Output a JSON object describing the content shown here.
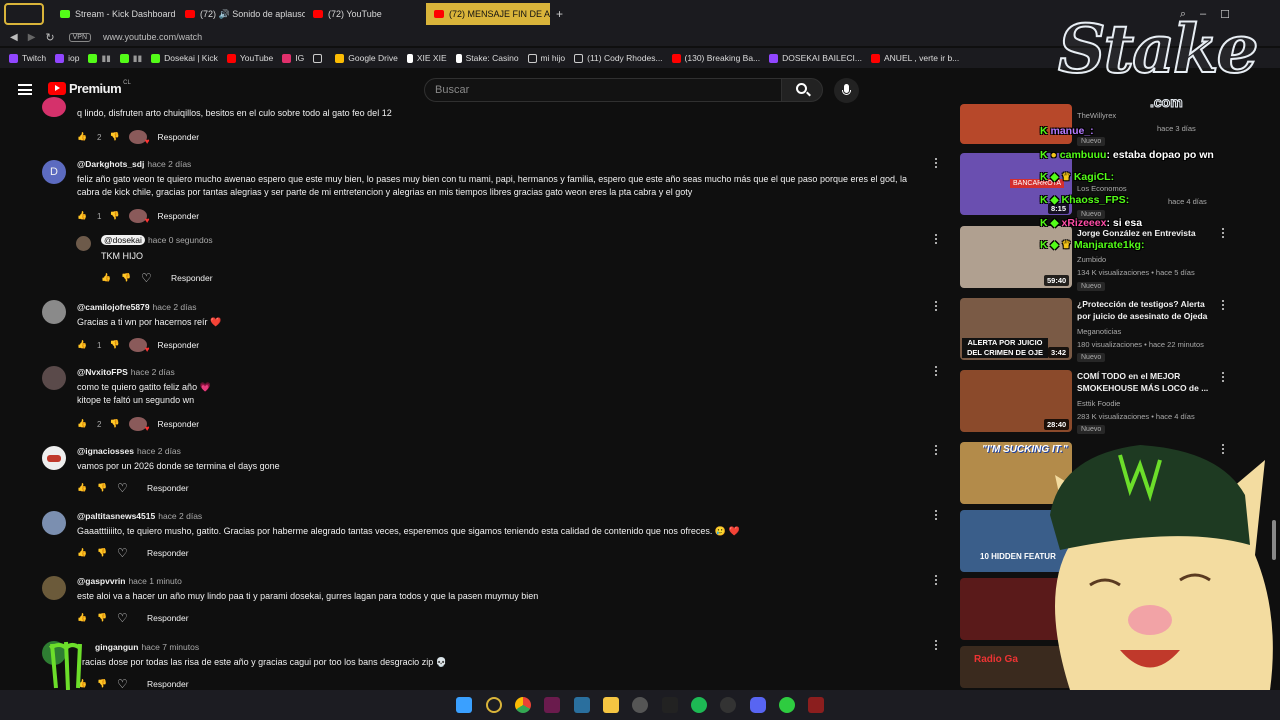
{
  "browser": {
    "tabs": [
      {
        "label": "Stream - Kick Dashboard",
        "color": "#53fc18"
      },
      {
        "label": "(72) 🔊 Sonido de aplauso",
        "color": "#ff0000"
      },
      {
        "label": "(72) YouTube",
        "color": "#ff0000"
      },
      {
        "label": "(72) MENSAJE FIN DE AÑO",
        "color": "#ff0000",
        "active": true
      }
    ],
    "vpn_label": "VPN",
    "url": "www.youtube.com/watch",
    "bookmarks": [
      {
        "label": "Twitch",
        "color": "#9146ff"
      },
      {
        "label": "iop",
        "color": "#9146ff"
      },
      {
        "label": "",
        "color": "#53fc18"
      },
      {
        "label": "",
        "color": "#53fc18"
      },
      {
        "label": "Dosekai | Kick",
        "color": "#53fc18"
      },
      {
        "label": "YouTube",
        "color": "#ff0000"
      },
      {
        "label": "IG",
        "color": "#e1306c"
      },
      {
        "label": "",
        "color": "#dddddd"
      },
      {
        "label": "Google Drive",
        "color": "#fbbc04"
      },
      {
        "label": "XIE XIE",
        "color": "#ffffff"
      },
      {
        "label": "Stake: Casino",
        "color": "#ffffff"
      },
      {
        "label": "mi hijo",
        "color": "#dddddd"
      },
      {
        "label": "(11) Cody Rhodes...",
        "color": "#dddddd"
      },
      {
        "label": "(130) Breaking Ba...",
        "color": "#ff0000"
      },
      {
        "label": "DOSEKAI BAILECI...",
        "color": "#9146ff"
      },
      {
        "label": "ANUEL , verte ir b...",
        "color": "#ff0000"
      }
    ]
  },
  "youtube": {
    "logo_text": "Premium",
    "logo_sup": "CL",
    "search_placeholder": "Buscar"
  },
  "comments": [
    {
      "handle": "",
      "time": "",
      "text": "q lindo, disfruten arto chuiqillos, besitos en el culo sobre todo al gato feo del 12",
      "likes": "2",
      "reply": "Responder",
      "avatar_color": "#d5316b",
      "creator_heart": true
    },
    {
      "handle": "@Darkghots_sdj",
      "time": "hace 2 días",
      "text": "feliz año gato weon te quiero mucho awenao espero que este muy bien, lo pases muy bien con tu mami, papi, hermanos y familia, espero que este año seas mucho más que el que paso porque eres el god, la",
      "text2": "cabra de kick chile, gracias por tantas alegrias y ser parte de mi entretencion y alegrias en mis tiempos libres gracias gato weon eres la pta cabra y el goty",
      "likes": "1",
      "reply": "Responder",
      "avatar_color": "#5c6bc0",
      "avatar_letter": "D",
      "creator_heart": true
    },
    {
      "handle": "@dosekai",
      "time": "hace 0 segundos",
      "text": "TKM HIJO",
      "likes": "",
      "reply": "Responder",
      "avatar_color": "#6d5a4a",
      "reply_thread": true
    },
    {
      "handle": "@camilojofre5879",
      "time": "hace 2 días",
      "text": "Gracias a ti wn por hacernos reír ❤️",
      "likes": "1",
      "reply": "Responder",
      "avatar_color": "#8a8a8a",
      "creator_heart": true
    },
    {
      "handle": "@NvxitoFPS",
      "time": "hace 2 días",
      "text": "como te quiero gatito feliz año 💗",
      "text2": "kitope te faltó un segundo wn",
      "likes": "2",
      "reply": "Responder",
      "avatar_color": "#5a4a4a",
      "creator_heart": true
    },
    {
      "handle": "@ignaciosses",
      "time": "hace 2 días",
      "text": "vamos por un 2026 donde se termina el days gone",
      "likes": "",
      "reply": "Responder",
      "avatar_color": "#c0392b"
    },
    {
      "handle": "@paltitasnews4515",
      "time": "hace 2 días",
      "text": "Gaaatttiiiito, te quiero musho, gatito. Gracias por haberme alegrado tantas veces, esperemos que sigamos teniendo esta calidad de contenido que nos ofreces. 🥲 ❤️",
      "likes": "",
      "reply": "Responder",
      "avatar_color": "#7b8fb0"
    },
    {
      "handle": "@gaspvvrin",
      "time": "hace 1 minuto",
      "text": "este aloi va a hacer un año muy lindo paa ti y parami dosekai, gurres lagan para todos y que la pasen muymuy bien",
      "likes": "",
      "reply": "Responder",
      "avatar_color": "#6b5a3a"
    },
    {
      "handle": "gingangun",
      "time": "hace 7 minutos",
      "text": "racias dose por todas las risa de este año y gracias cagui por too los bans desgracio zip 💀",
      "likes": "",
      "reply": "Responder",
      "avatar_color": "#2e7d32"
    }
  ],
  "sidebar": [
    {
      "title": "",
      "channel": "TheWillyrex",
      "meta": "",
      "meta2": "hace 3 días",
      "badge": "Nuevo",
      "duration": "",
      "color": "#b7482a"
    },
    {
      "title": "",
      "channel": "Los Economos",
      "meta": "",
      "meta2": "hace 4 días",
      "badge": "Nuevo",
      "duration": "8:15",
      "color": "#7e57c2"
    },
    {
      "title": "Jorge González en Entrevista",
      "channel": "Zumbido",
      "meta": "134 K visualizaciones • hace 5 días",
      "badge": "Nuevo",
      "duration": "59:40",
      "color": "#8d7b6a"
    },
    {
      "title": "¿Protección de testigos? Alerta por juicio de asesinato de Ojeda",
      "channel": "Meganoticias",
      "meta": "180 visualizaciones • hace 22 minutos",
      "badge": "Nuevo",
      "duration": "3:42",
      "color": "#7a5a45",
      "thumb_text": "ALERTA POR JUICIO DEL CRIMEN DE OJE"
    },
    {
      "title": "COMÍ TODO en el MEJOR SMOKEHOUSE MÁS LOCO de ...",
      "channel": "Esttik Foodie",
      "meta": "283 K visualizaciones • hace 4 días",
      "badge": "Nuevo",
      "duration": "28:40",
      "color": "#8b4a2b"
    },
    {
      "title": "",
      "channel": "",
      "meta": "",
      "badge": "",
      "duration": "",
      "color": "#b38b4a",
      "thumb_text": "\"I'M SUCKING IT.\""
    },
    {
      "title": "",
      "channel": "",
      "meta": "",
      "badge": "",
      "duration": "",
      "color": "#3a5e8a",
      "thumb_text": "10 HIDDEN FEATUR"
    },
    {
      "title": "",
      "channel": "",
      "meta": "",
      "badge": "",
      "duration": "",
      "color": "#5a1a1a"
    },
    {
      "title": "",
      "channel": "",
      "meta": "",
      "badge": "",
      "duration": "",
      "color": "#3a2a1e",
      "thumb_text": "Radio Ga"
    }
  ],
  "overlay": {
    "brand": "Stake",
    "brand_sub": ".com",
    "chat": [
      {
        "user": "manue_:",
        "msg": "",
        "color": "#b57bff"
      },
      {
        "user": "cambuuu",
        "msg": ": estaba dopao po wn",
        "color": "#53fc18"
      },
      {
        "user": "KagiCL:",
        "msg": "",
        "color": "#53fc18"
      },
      {
        "user": "Khaoss_FPS:",
        "msg": "",
        "color": "#53fc18"
      },
      {
        "user": "xRizeeex",
        "msg": ": si esa",
        "color": "#ff4da6"
      },
      {
        "user": "Manjarate1kg:",
        "msg": "",
        "color": "#53fc18"
      }
    ]
  }
}
